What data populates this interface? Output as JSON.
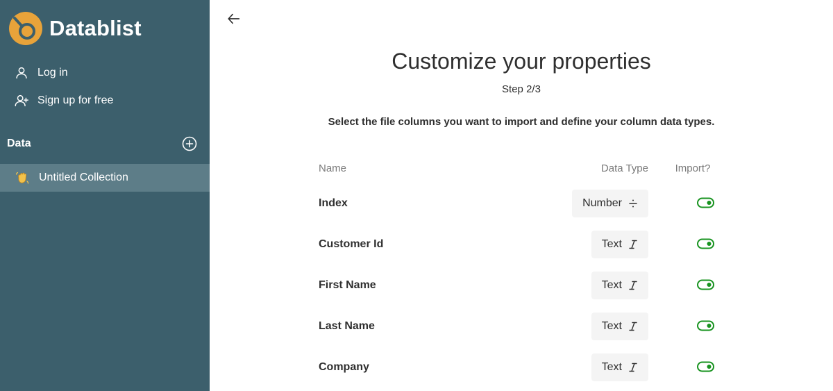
{
  "sidebar": {
    "brand": {
      "name": "Datablist",
      "color": "#e8a33a",
      "icon": "datablist-logo-icon"
    },
    "nav": [
      {
        "label": "Log in",
        "icon": "user-icon"
      },
      {
        "label": "Sign up for free",
        "icon": "user-plus-icon"
      }
    ],
    "section": {
      "label": "Data",
      "icon": "plus-circle-icon"
    },
    "collections": [
      {
        "label": "Untitled Collection",
        "icon": "waving-hand-icon"
      }
    ],
    "background": "#3c5f6c",
    "active_background": "#5d7d88"
  },
  "main": {
    "back_icon": "arrow-left-icon",
    "title": "Customize your properties",
    "step": "Step 2/3",
    "instructions": "Select the file columns you want to import and define your column data types.",
    "columns": {
      "name": "Name",
      "type": "Data Type",
      "import": "Import?"
    },
    "rows": [
      {
        "name": "Index",
        "type": "Number",
        "type_icon": "divide-icon",
        "import": true
      },
      {
        "name": "Customer Id",
        "type": "Text",
        "type_icon": "italic-i-icon",
        "import": true
      },
      {
        "name": "First Name",
        "type": "Text",
        "type_icon": "italic-i-icon",
        "import": true
      },
      {
        "name": "Last Name",
        "type": "Text",
        "type_icon": "italic-i-icon",
        "import": true
      },
      {
        "name": "Company",
        "type": "Text",
        "type_icon": "italic-i-icon",
        "import": true
      }
    ],
    "toggle_color": "#17931f"
  }
}
